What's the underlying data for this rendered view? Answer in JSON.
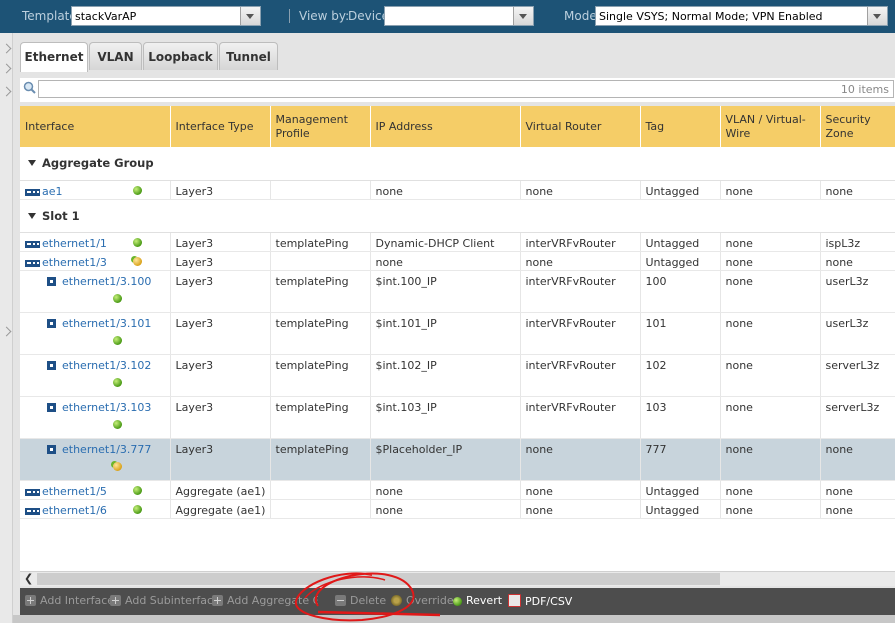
{
  "topbar": {
    "template_label": "Template",
    "template_value": "stackVarAP",
    "viewby_label": "View by:",
    "device_label": "Device",
    "device_value": "",
    "mode_label": "Mode",
    "mode_value": "Single VSYS; Normal Mode; VPN Enabled"
  },
  "tabs": [
    "Ethernet",
    "VLAN",
    "Loopback",
    "Tunnel"
  ],
  "active_tab": "Ethernet",
  "search": {
    "placeholder": "",
    "count": "10 items"
  },
  "columns": [
    "Interface",
    "Interface Type",
    "Management Profile",
    "IP Address",
    "Virtual Router",
    "Tag",
    "VLAN / Virtual-Wire",
    "Security Zone"
  ],
  "groups": [
    {
      "name": "Aggregate Group",
      "rows": [
        {
          "iface": "ae1",
          "kind": "port",
          "status": "up",
          "type": "Layer3",
          "profile": "",
          "ip": "none",
          "vr": "none",
          "tag": "Untagged",
          "vlan": "none",
          "zone": "none"
        }
      ]
    },
    {
      "name": "Slot 1",
      "rows": [
        {
          "iface": "ethernet1/1",
          "kind": "port",
          "status": "up",
          "type": "Layer3",
          "profile": "templatePing",
          "ip": "Dynamic-DHCP Client",
          "vr": "interVRFvRouter",
          "tag": "Untagged",
          "vlan": "none",
          "zone": "ispL3z"
        },
        {
          "iface": "ethernet1/3",
          "kind": "port",
          "status": "multi",
          "type": "Layer3",
          "profile": "",
          "ip": "none",
          "vr": "none",
          "tag": "Untagged",
          "vlan": "none",
          "zone": "none"
        },
        {
          "iface": "ethernet1/3.100",
          "kind": "sub",
          "status": "up",
          "type": "Layer3",
          "profile": "templatePing",
          "ip": "$int.100_IP",
          "vr": "interVRFvRouter",
          "tag": "100",
          "vlan": "none",
          "zone": "userL3z"
        },
        {
          "iface": "ethernet1/3.101",
          "kind": "sub",
          "status": "up",
          "type": "Layer3",
          "profile": "templatePing",
          "ip": "$int.101_IP",
          "vr": "interVRFvRouter",
          "tag": "101",
          "vlan": "none",
          "zone": "userL3z"
        },
        {
          "iface": "ethernet1/3.102",
          "kind": "sub",
          "status": "up",
          "type": "Layer3",
          "profile": "templatePing",
          "ip": "$int.102_IP",
          "vr": "interVRFvRouter",
          "tag": "102",
          "vlan": "none",
          "zone": "serverL3z"
        },
        {
          "iface": "ethernet1/3.103",
          "kind": "sub",
          "status": "up",
          "type": "Layer3",
          "profile": "templatePing",
          "ip": "$int.103_IP",
          "vr": "interVRFvRouter",
          "tag": "103",
          "vlan": "none",
          "zone": "serverL3z"
        },
        {
          "iface": "ethernet1/3.777",
          "kind": "sub",
          "status": "multi",
          "selected": true,
          "type": "Layer3",
          "profile": "templatePing",
          "ip": "$Placeholder_IP",
          "vr": "none",
          "tag": "777",
          "vlan": "none",
          "zone": "none"
        },
        {
          "iface": "ethernet1/5",
          "kind": "port",
          "status": "up",
          "type": "Aggregate (ae1)",
          "profile": "",
          "ip": "none",
          "vr": "none",
          "tag": "Untagged",
          "vlan": "none",
          "zone": "none"
        },
        {
          "iface": "ethernet1/6",
          "kind": "port",
          "status": "up",
          "type": "Aggregate (ae1)",
          "profile": "",
          "ip": "none",
          "vr": "none",
          "tag": "Untagged",
          "vlan": "none",
          "zone": "none"
        }
      ]
    }
  ],
  "toolbar": {
    "add_interface": "Add Interface",
    "add_subinterface": "Add Subinterface",
    "add_aggregate_group": "Add Aggregate Group",
    "delete": "Delete",
    "override": "Override",
    "revert": "Revert",
    "pdf_csv": "PDF/CSV"
  },
  "colors": {
    "header_bar": "#1d5376",
    "table_header": "#f5cd67",
    "link": "#2a6db0",
    "selected_row": "#c8d4dc",
    "toolbar": "#4d4d4d",
    "annotation_circle": "#e01818"
  }
}
